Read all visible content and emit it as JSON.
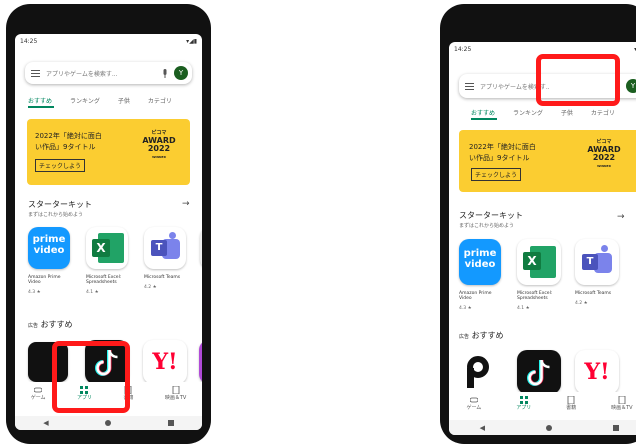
{
  "colors": {
    "accent": "#01875f",
    "highlight": "#ff1a1a",
    "banner": "#fbcd31"
  },
  "status": {
    "time": "14:25"
  },
  "search": {
    "placeholder": "アプリやゲームを検索す...",
    "placeholder_right": "アプリやゲームを検索す..",
    "avatar": "Y"
  },
  "tabs": [
    "おすすめ",
    "ランキング",
    "子供",
    "カテゴリ"
  ],
  "banner": {
    "line1": "2022年「絶対に面白",
    "line2": "い作品」9タイトル",
    "button": "チェックしよう",
    "award_brand": "ピコマ",
    "award_word": "AWARD",
    "award_year": "2022",
    "award_sub": "WINNER"
  },
  "starter": {
    "title": "スターターキット",
    "subtitle": "まずはこれから始めよう"
  },
  "apps": [
    {
      "name": "Amazon Prime Video",
      "rating": "4.3 ★",
      "icon": "prime-video-icon"
    },
    {
      "name": "Microsoft Excel: Spreadsheets",
      "rating": "4.1 ★",
      "icon": "excel-icon"
    },
    {
      "name": "Microsoft Teams",
      "rating": "4.2 ★",
      "icon": "teams-icon"
    }
  ],
  "prime_icon": {
    "line1": "prime",
    "line2": "video"
  },
  "excel_letter": "X",
  "teams_letter": "T",
  "ads": {
    "badge": "広告",
    "title": "おすすめ"
  },
  "yahoo_text": "Y!",
  "bottom_nav": [
    {
      "label": "ゲーム",
      "icon": "gamepad-icon"
    },
    {
      "label": "アプリ",
      "icon": "apps-icon"
    },
    {
      "label": "書籍",
      "icon": "book-icon"
    },
    {
      "label": "映画＆TV",
      "icon": "movie-icon"
    }
  ]
}
